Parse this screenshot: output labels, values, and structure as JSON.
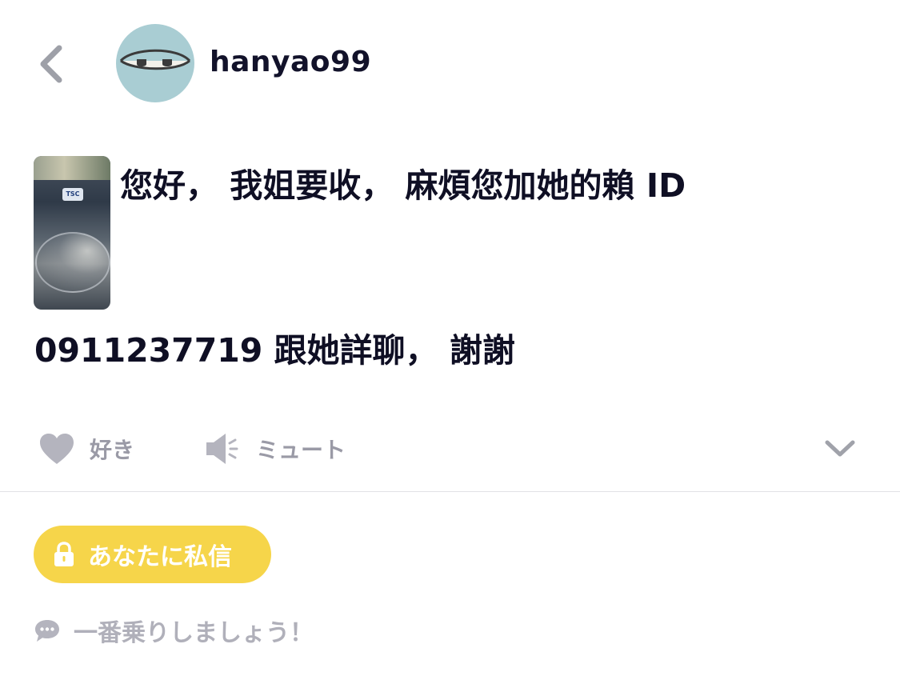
{
  "header": {
    "back_icon": "chevron-left-icon",
    "avatar_icon": "sleepy-eyes-avatar",
    "avatar_color": "#a9cdd3",
    "username": "hanyao99"
  },
  "post": {
    "thumbnail_label": "TSC",
    "line1": "您好， 我姐要收， 麻煩您加她的賴 ID",
    "line2": "0911237719 跟她詳聊， 謝謝"
  },
  "actions": {
    "like_label": "好き",
    "mute_label": "ミュート",
    "more_icon": "chevron-down-icon"
  },
  "dm": {
    "label": "あなたに私信",
    "icon": "lock-icon",
    "color": "#f6d54a"
  },
  "comment": {
    "placeholder": "一番乗りしましょう！",
    "icon": "speech-bubble-icon"
  }
}
